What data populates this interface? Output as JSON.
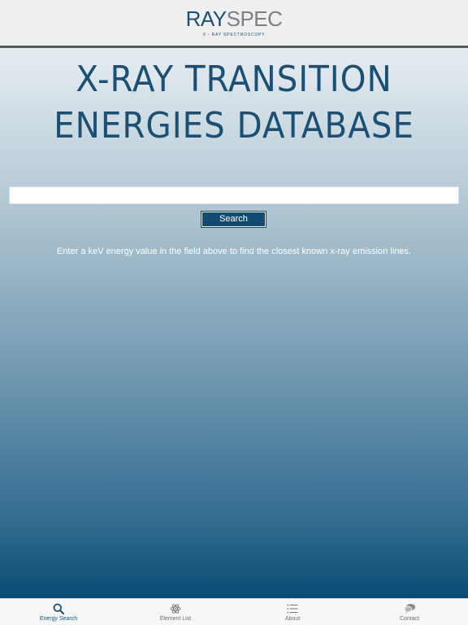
{
  "header": {
    "logo_primary": "RAY",
    "logo_secondary": "SPEC",
    "logo_tagline": "X - RAY SPECTROSCOPY"
  },
  "main": {
    "title_line1": "X-RAY TRANSITION",
    "title_line2": "ENERGIES DATABASE",
    "search_value": "",
    "search_placeholder": "",
    "search_button_label": "Search",
    "hint_text": "Enter a keV energy value in the field above to find the closest known x-ray emission lines."
  },
  "tabbar": {
    "tabs": [
      {
        "label": "Energy Search",
        "icon": "search-icon",
        "active": true
      },
      {
        "label": "Element List",
        "icon": "atom-icon",
        "active": false
      },
      {
        "label": "About",
        "icon": "list-icon",
        "active": false
      },
      {
        "label": "Contact",
        "icon": "speech-bubble-icon",
        "active": false
      }
    ]
  },
  "colors": {
    "brand_blue": "#1b4f74",
    "button_blue": "#134c73",
    "tab_active": "#1b4f74",
    "tab_inactive": "#6c6c6c"
  }
}
